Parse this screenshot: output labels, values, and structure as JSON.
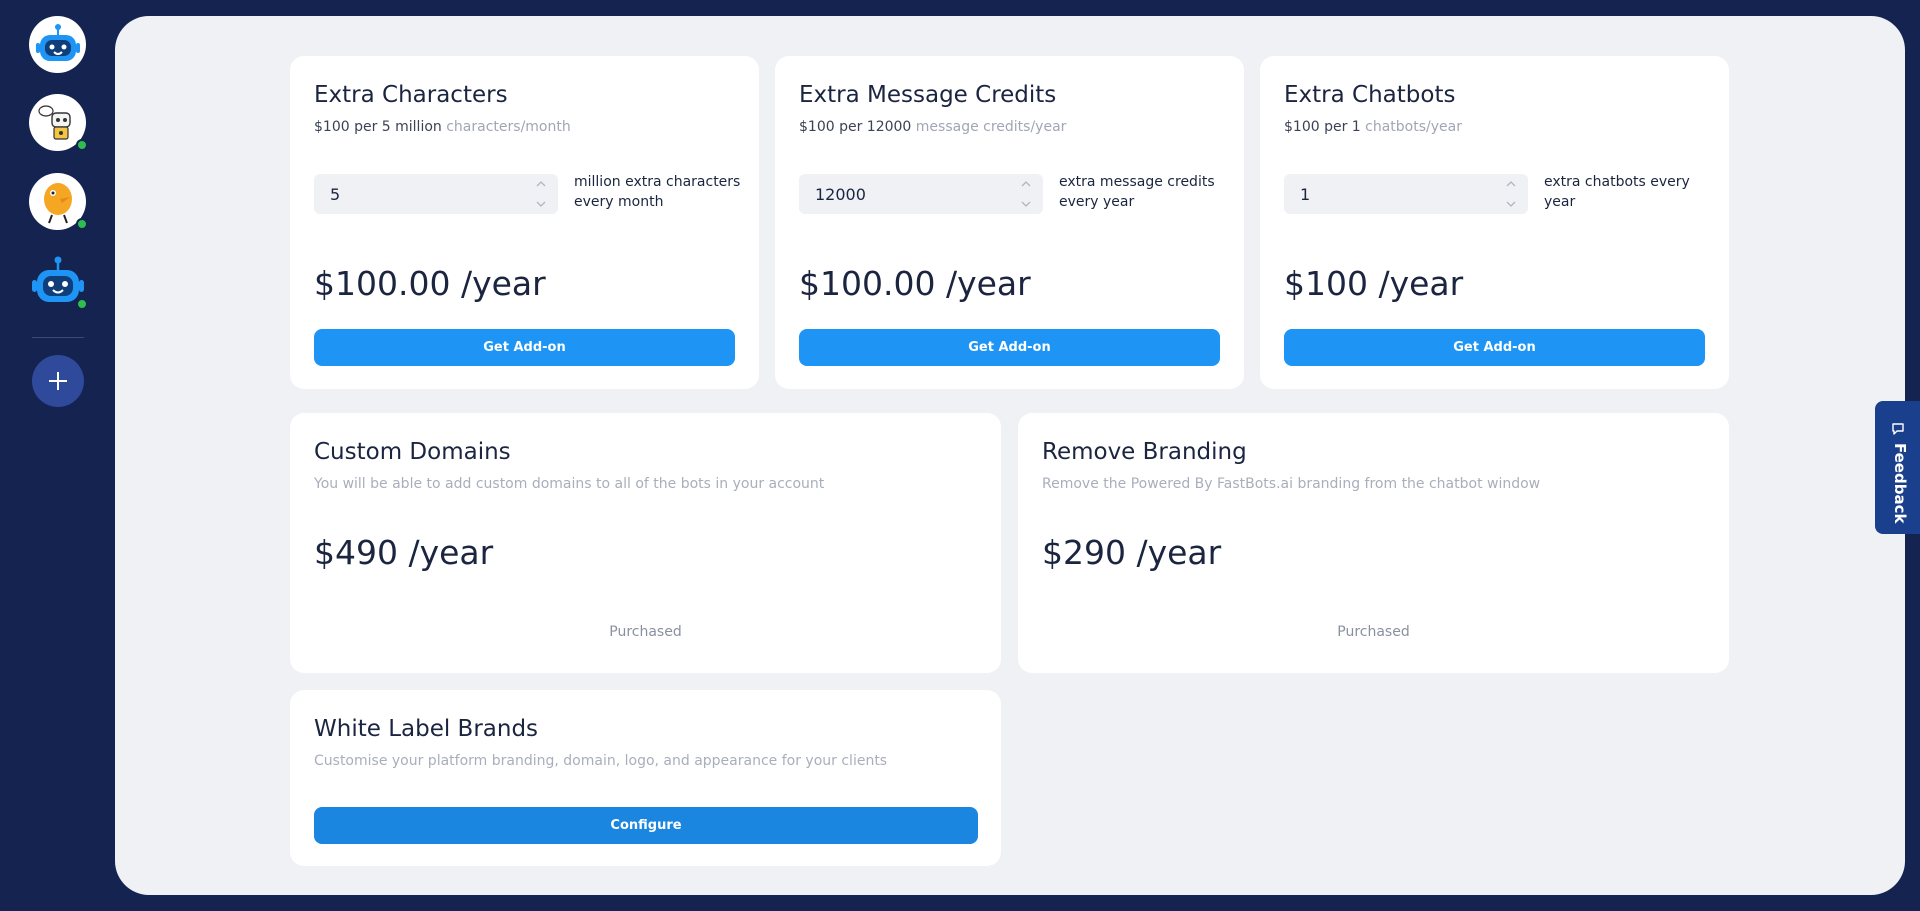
{
  "sidebar": {
    "bots": [
      {
        "icon": "robot-logo-icon",
        "online": false
      },
      {
        "icon": "robot-thinking-icon",
        "online": true
      },
      {
        "icon": "yellow-mascot-icon",
        "online": true
      },
      {
        "icon": "robot-face-icon",
        "online": true
      }
    ],
    "add_icon": "plus-icon"
  },
  "addons": [
    {
      "title": "Extra Characters",
      "price_line": "$100 per 5 million",
      "unit": "characters/month",
      "qty": "5",
      "qty_label": "million extra characters every month",
      "price": "$100.00 /year",
      "button": "Get Add-on"
    },
    {
      "title": "Extra Message Credits",
      "price_line": "$100 per 12000",
      "unit": "message credits/year",
      "qty": "12000",
      "qty_label": "extra message credits every year",
      "price": "$100.00 /year",
      "button": "Get Add-on"
    },
    {
      "title": "Extra Chatbots",
      "price_line": "$100 per 1",
      "unit": "chatbots/year",
      "qty": "1",
      "qty_label": "extra chatbots every year",
      "price": "$100 /year",
      "button": "Get Add-on"
    }
  ],
  "custom_domains": {
    "title": "Custom Domains",
    "description": "You will be able to add custom domains to all of the bots in your account",
    "price": "$490 /year",
    "status": "Purchased"
  },
  "remove_branding": {
    "title": "Remove Branding",
    "description": "Remove the Powered By FastBots.ai branding from the chatbot window",
    "price": "$290 /year",
    "status": "Purchased"
  },
  "white_label": {
    "title": "White Label Brands",
    "description": "Customise your platform branding, domain, logo, and appearance for your clients",
    "button": "Configure"
  },
  "feedback": {
    "label": "Feedback",
    "icon": "chat-bubble-icon"
  },
  "colors": {
    "sidebar_bg": "#142350",
    "main_bg": "#eff1f5",
    "accent": "#1e95f5",
    "online": "#2ebd4e",
    "feedback_bg": "#1a3f8c"
  }
}
